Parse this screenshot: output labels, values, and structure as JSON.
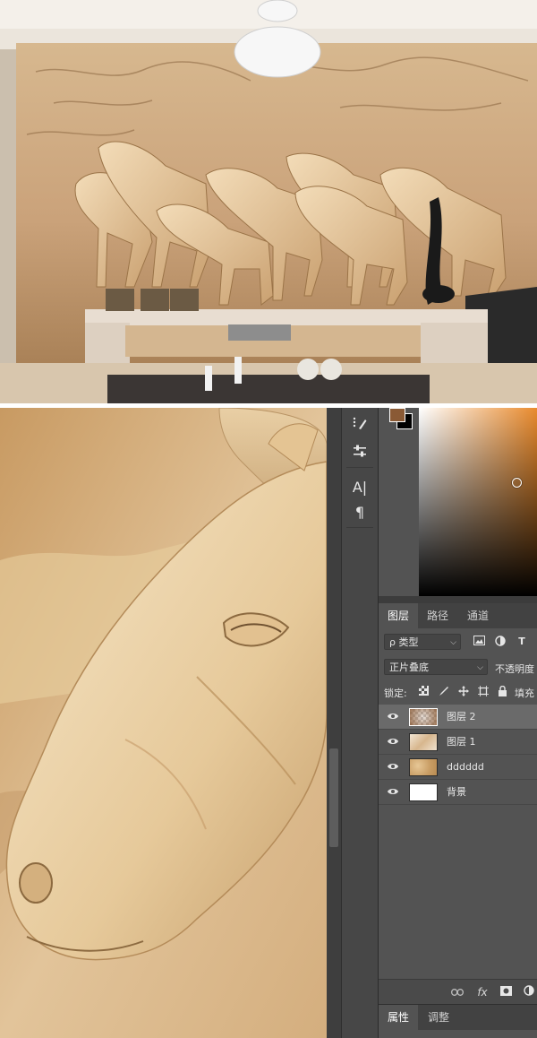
{
  "tools": {
    "brush_settings": "brush-settings",
    "adjust": "adjust-sliders",
    "character": "A|",
    "paragraph": "¶"
  },
  "colors": {
    "foreground": "#8a5a35",
    "background": "#000000",
    "picker_hue": "#e98a2c"
  },
  "layers_panel": {
    "tabs": [
      {
        "label": "图层",
        "active": true
      },
      {
        "label": "路径",
        "active": false
      },
      {
        "label": "通道",
        "active": false
      }
    ],
    "filter": {
      "placeholder": "类型",
      "kind_prefix": "ρ"
    },
    "blend_mode": "正片叠底",
    "opacity_label": "不透明度",
    "lock_label": "锁定:",
    "fill_label": "填充",
    "layers": [
      {
        "name": "图层 2",
        "selected": true,
        "visible": true
      },
      {
        "name": "图层 1",
        "selected": false,
        "visible": true
      },
      {
        "name": "dddddd",
        "selected": false,
        "visible": true
      },
      {
        "name": "背景",
        "selected": false,
        "visible": true
      }
    ],
    "footer_fx": "fx"
  },
  "properties_panel": {
    "tabs": [
      {
        "label": "属性",
        "active": true
      },
      {
        "label": "调整",
        "active": false
      }
    ]
  }
}
